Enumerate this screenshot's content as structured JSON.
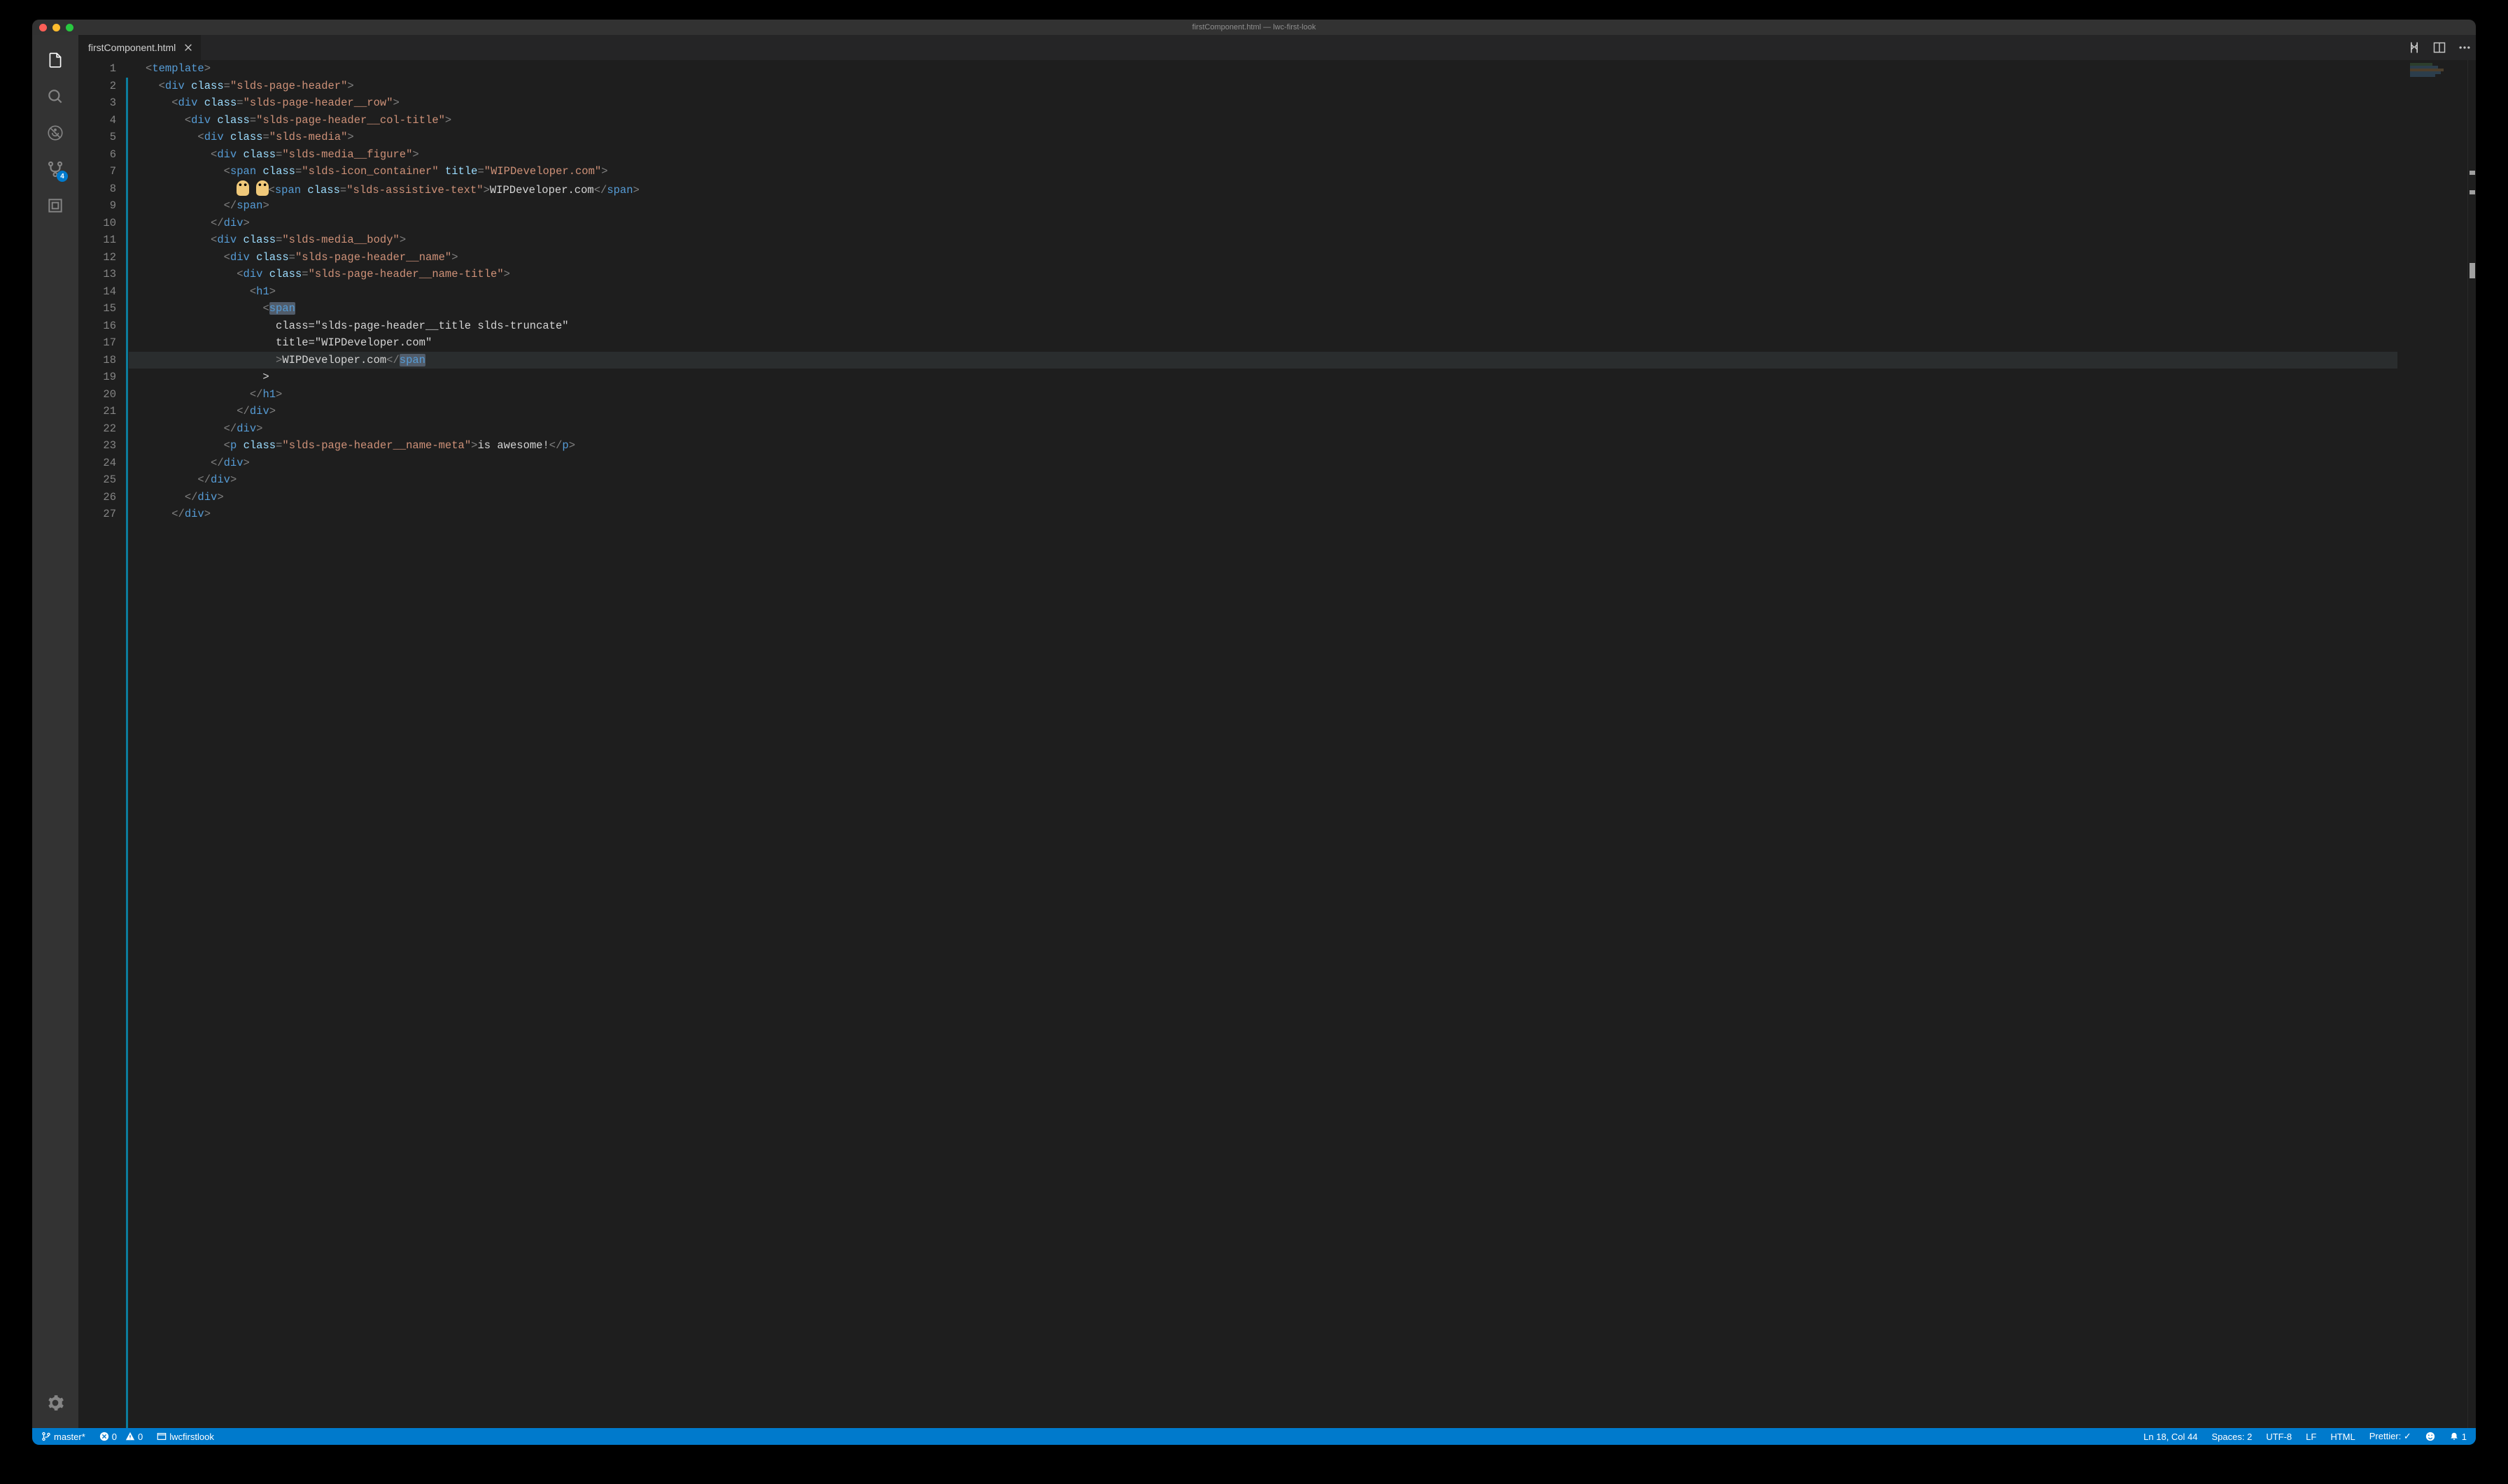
{
  "titlebar": {
    "title": "firstComponent.html — lwc-first-look"
  },
  "activitybar": {
    "scm_badge": "4"
  },
  "tabs": {
    "active": "firstComponent.html"
  },
  "editor": {
    "line_count": 27,
    "current_line": 18,
    "lines": [
      {
        "n": 1,
        "raw": "<template>"
      },
      {
        "n": 2,
        "raw": "  <div class=\"slds-page-header\">"
      },
      {
        "n": 3,
        "raw": "    <div class=\"slds-page-header__row\">"
      },
      {
        "n": 4,
        "raw": "      <div class=\"slds-page-header__col-title\">"
      },
      {
        "n": 5,
        "raw": "        <div class=\"slds-media\">"
      },
      {
        "n": 6,
        "raw": "          <div class=\"slds-media__figure\">"
      },
      {
        "n": 7,
        "raw": "            <span class=\"slds-icon_container\" title=\"WIPDeveloper.com\">"
      },
      {
        "n": 8,
        "raw": "              👩‍💻 👩‍💻<span class=\"slds-assistive-text\">WIPDeveloper.com</span>"
      },
      {
        "n": 9,
        "raw": "            </span>"
      },
      {
        "n": 10,
        "raw": "          </div>"
      },
      {
        "n": 11,
        "raw": "          <div class=\"slds-media__body\">"
      },
      {
        "n": 12,
        "raw": "            <div class=\"slds-page-header__name\">"
      },
      {
        "n": 13,
        "raw": "              <div class=\"slds-page-header__name-title\">"
      },
      {
        "n": 14,
        "raw": "                <h1>"
      },
      {
        "n": 15,
        "raw": "                  <span"
      },
      {
        "n": 16,
        "raw": "                    class=\"slds-page-header__title slds-truncate\""
      },
      {
        "n": 17,
        "raw": "                    title=\"WIPDeveloper.com\""
      },
      {
        "n": 18,
        "raw": "                    >WIPDeveloper.com</span"
      },
      {
        "n": 19,
        "raw": "                  >"
      },
      {
        "n": 20,
        "raw": "                </h1>"
      },
      {
        "n": 21,
        "raw": "              </div>"
      },
      {
        "n": 22,
        "raw": "            </div>"
      },
      {
        "n": 23,
        "raw": "            <p class=\"slds-page-header__name-meta\">is awesome!</p>"
      },
      {
        "n": 24,
        "raw": "          </div>"
      },
      {
        "n": 25,
        "raw": "        </div>"
      },
      {
        "n": 26,
        "raw": "      </div>"
      },
      {
        "n": 27,
        "raw": "    </div>"
      }
    ]
  },
  "status": {
    "branch": "master*",
    "errors": "0",
    "warnings": "0",
    "org": "lwcfirstlook",
    "cursor": "Ln 18, Col 44",
    "indent": "Spaces: 2",
    "encoding": "UTF-8",
    "eol": "LF",
    "language": "HTML",
    "formatter": "Prettier: ✓",
    "bell_count": "1"
  }
}
